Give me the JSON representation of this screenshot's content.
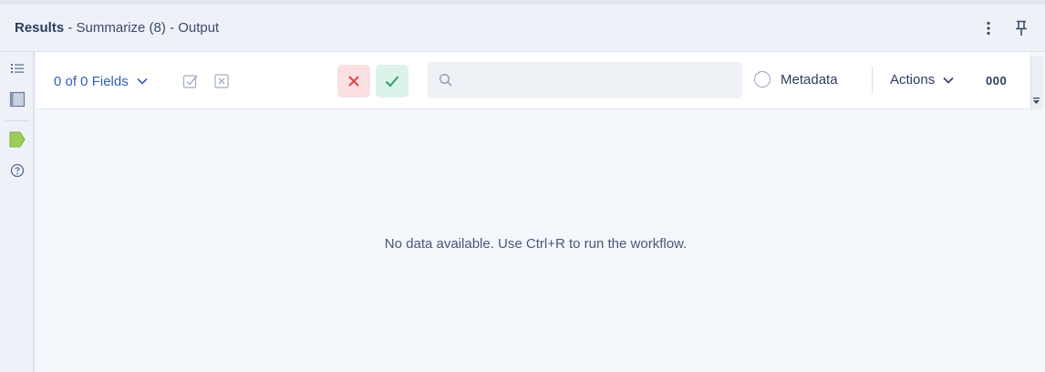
{
  "header": {
    "title_bold": "Results",
    "title_rest": " - Summarize (8) - Output",
    "icons": [
      "more-vertical-icon",
      "pin-icon"
    ]
  },
  "rail": {
    "icons": [
      "list-icon",
      "table-icon",
      "tag-icon",
      "help-icon"
    ],
    "active_color": "#9ccc5a"
  },
  "toolbar": {
    "fields_label": "0 of 0 Fields",
    "search_placeholder": "",
    "metadata_label": "Metadata",
    "actions_label": "Actions",
    "overflow_label": "000",
    "deselect_color": "#e2424d",
    "confirm_color": "#2ba36b"
  },
  "main": {
    "empty_message": "No data available. Use Ctrl+R to run the workflow."
  }
}
